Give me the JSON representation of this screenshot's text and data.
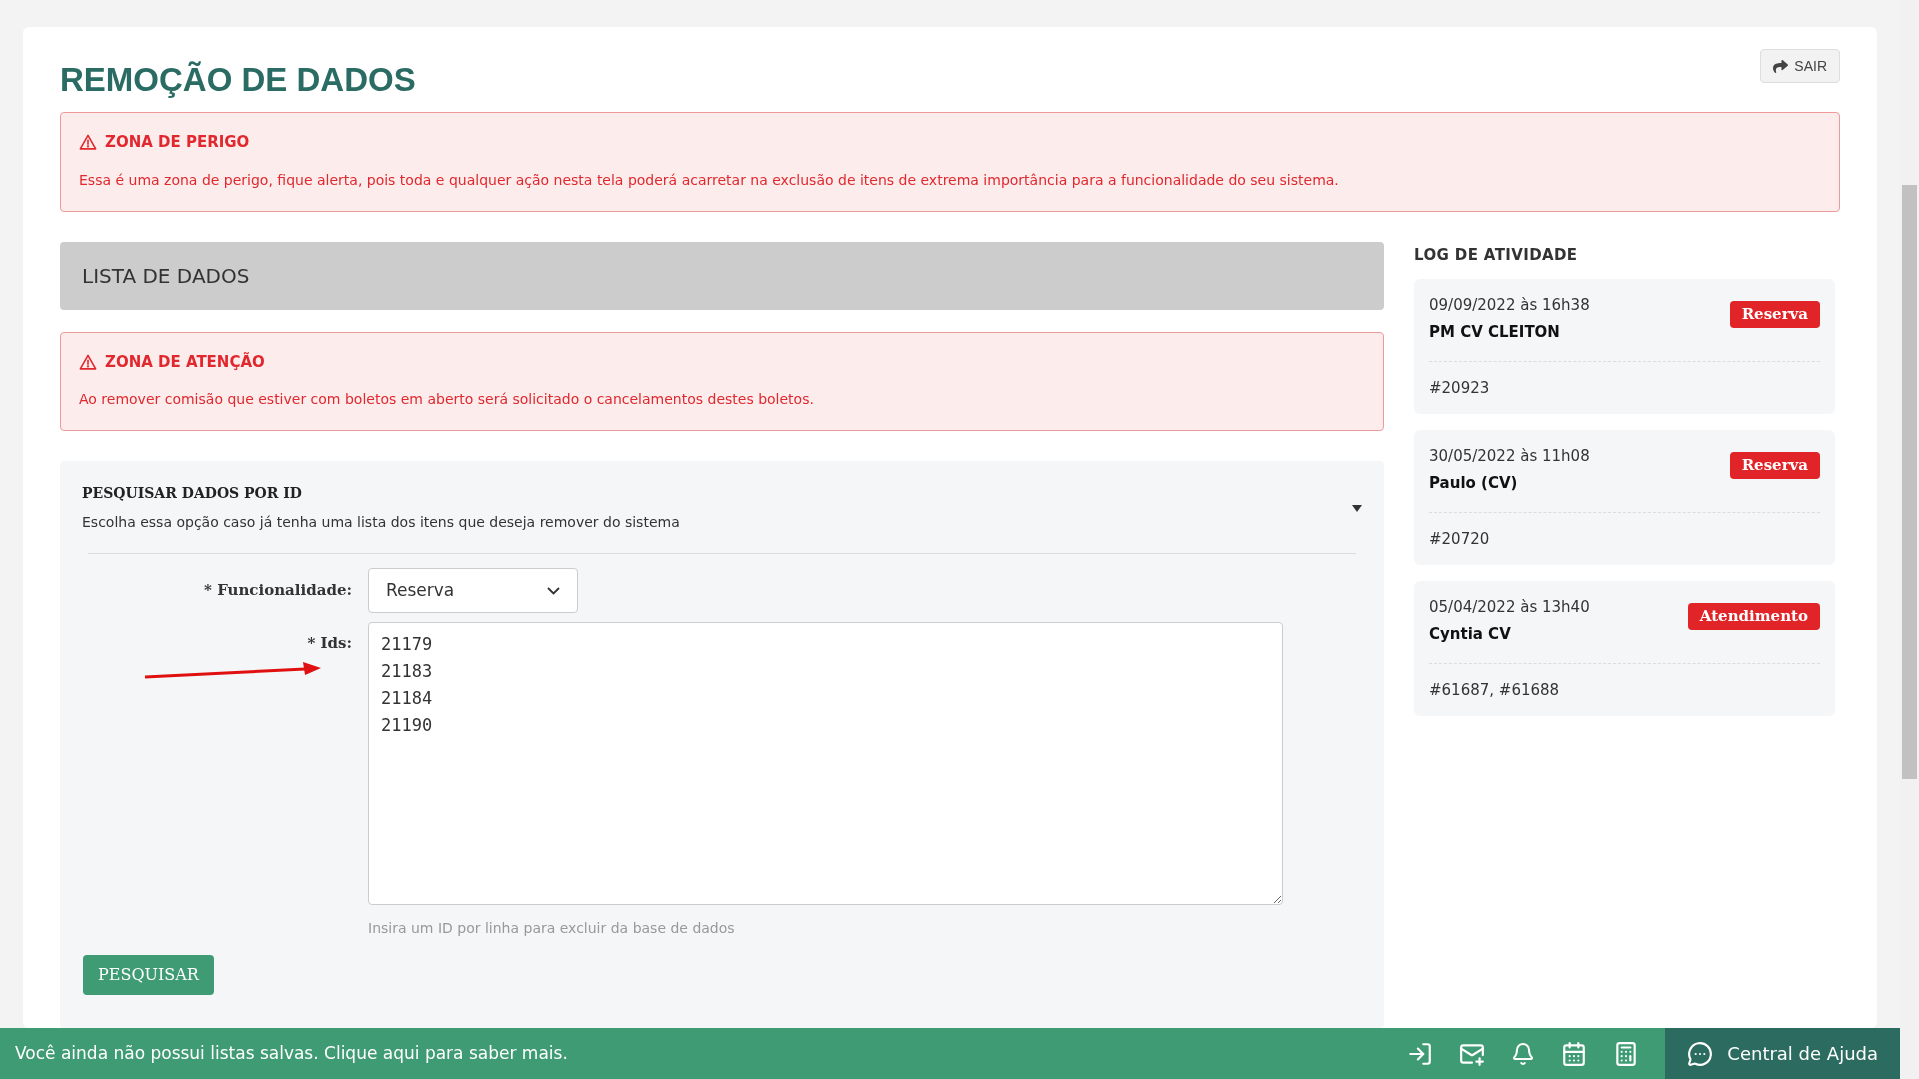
{
  "page": {
    "title": "REMOÇÃO DE DADOS",
    "exit_button": "SAIR"
  },
  "danger_alert": {
    "title": "ZONA DE PERIGO",
    "message": "Essa é uma zona de perigo, fique alerta, pois toda e qualquer ação nesta tela poderá acarretar na exclusão de itens de extrema importância para a funcionalidade do seu sistema."
  },
  "list_header": "LISTA DE DADOS",
  "attention_alert": {
    "title": "ZONA DE ATENÇÃO",
    "message": "Ao remover comisão que estiver com boletos em aberto será solicitado o cancelamentos destes boletos."
  },
  "search_panel": {
    "title": "PESQUISAR DADOS POR ID",
    "description": "Escolha essa opção caso já tenha uma lista dos itens que deseja remover do sistema",
    "expanded": true,
    "functionality_label": "* Funcionalidade:",
    "functionality_value": "Reserva",
    "ids_label": "* Ids:",
    "ids_value": "21179\n21183\n21184\n21190",
    "ids_help": "Insira um ID por linha para excluir da base de dados",
    "search_button": "PESQUISAR"
  },
  "activity_log": {
    "title": "LOG DE ATIVIDADE",
    "entries": [
      {
        "datetime": "09/09/2022 às 16h38",
        "user": "PM CV CLEITON",
        "tag": "Reserva",
        "ids": "#20923"
      },
      {
        "datetime": "30/05/2022 às 11h08",
        "user": "Paulo (CV)",
        "tag": "Reserva",
        "ids": "#20720"
      },
      {
        "datetime": "05/04/2022 às 13h40",
        "user": "Cyntia CV",
        "tag": "Atendimento",
        "ids": "#61687, #61688"
      }
    ]
  },
  "bottom_bar": {
    "message": "Você ainda não possui listas salvas. Clique aqui para saber mais.",
    "help_button": "Central de Ajuda"
  }
}
